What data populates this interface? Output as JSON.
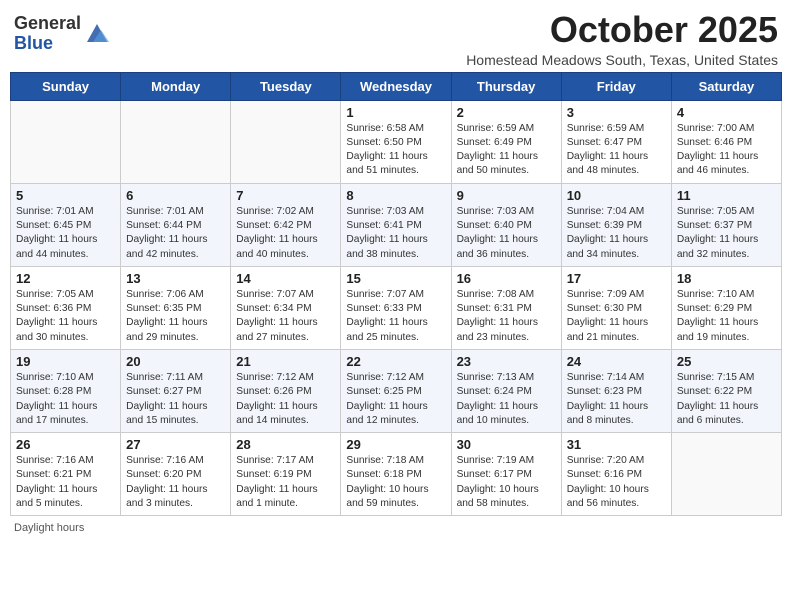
{
  "header": {
    "logo_general": "General",
    "logo_blue": "Blue",
    "month_title": "October 2025",
    "subtitle": "Homestead Meadows South, Texas, United States"
  },
  "weekdays": [
    "Sunday",
    "Monday",
    "Tuesday",
    "Wednesday",
    "Thursday",
    "Friday",
    "Saturday"
  ],
  "footer": "Daylight hours",
  "weeks": [
    [
      {
        "day": "",
        "info": ""
      },
      {
        "day": "",
        "info": ""
      },
      {
        "day": "",
        "info": ""
      },
      {
        "day": "1",
        "info": "Sunrise: 6:58 AM\nSunset: 6:50 PM\nDaylight: 11 hours and 51 minutes."
      },
      {
        "day": "2",
        "info": "Sunrise: 6:59 AM\nSunset: 6:49 PM\nDaylight: 11 hours and 50 minutes."
      },
      {
        "day": "3",
        "info": "Sunrise: 6:59 AM\nSunset: 6:47 PM\nDaylight: 11 hours and 48 minutes."
      },
      {
        "day": "4",
        "info": "Sunrise: 7:00 AM\nSunset: 6:46 PM\nDaylight: 11 hours and 46 minutes."
      }
    ],
    [
      {
        "day": "5",
        "info": "Sunrise: 7:01 AM\nSunset: 6:45 PM\nDaylight: 11 hours and 44 minutes."
      },
      {
        "day": "6",
        "info": "Sunrise: 7:01 AM\nSunset: 6:44 PM\nDaylight: 11 hours and 42 minutes."
      },
      {
        "day": "7",
        "info": "Sunrise: 7:02 AM\nSunset: 6:42 PM\nDaylight: 11 hours and 40 minutes."
      },
      {
        "day": "8",
        "info": "Sunrise: 7:03 AM\nSunset: 6:41 PM\nDaylight: 11 hours and 38 minutes."
      },
      {
        "day": "9",
        "info": "Sunrise: 7:03 AM\nSunset: 6:40 PM\nDaylight: 11 hours and 36 minutes."
      },
      {
        "day": "10",
        "info": "Sunrise: 7:04 AM\nSunset: 6:39 PM\nDaylight: 11 hours and 34 minutes."
      },
      {
        "day": "11",
        "info": "Sunrise: 7:05 AM\nSunset: 6:37 PM\nDaylight: 11 hours and 32 minutes."
      }
    ],
    [
      {
        "day": "12",
        "info": "Sunrise: 7:05 AM\nSunset: 6:36 PM\nDaylight: 11 hours and 30 minutes."
      },
      {
        "day": "13",
        "info": "Sunrise: 7:06 AM\nSunset: 6:35 PM\nDaylight: 11 hours and 29 minutes."
      },
      {
        "day": "14",
        "info": "Sunrise: 7:07 AM\nSunset: 6:34 PM\nDaylight: 11 hours and 27 minutes."
      },
      {
        "day": "15",
        "info": "Sunrise: 7:07 AM\nSunset: 6:33 PM\nDaylight: 11 hours and 25 minutes."
      },
      {
        "day": "16",
        "info": "Sunrise: 7:08 AM\nSunset: 6:31 PM\nDaylight: 11 hours and 23 minutes."
      },
      {
        "day": "17",
        "info": "Sunrise: 7:09 AM\nSunset: 6:30 PM\nDaylight: 11 hours and 21 minutes."
      },
      {
        "day": "18",
        "info": "Sunrise: 7:10 AM\nSunset: 6:29 PM\nDaylight: 11 hours and 19 minutes."
      }
    ],
    [
      {
        "day": "19",
        "info": "Sunrise: 7:10 AM\nSunset: 6:28 PM\nDaylight: 11 hours and 17 minutes."
      },
      {
        "day": "20",
        "info": "Sunrise: 7:11 AM\nSunset: 6:27 PM\nDaylight: 11 hours and 15 minutes."
      },
      {
        "day": "21",
        "info": "Sunrise: 7:12 AM\nSunset: 6:26 PM\nDaylight: 11 hours and 14 minutes."
      },
      {
        "day": "22",
        "info": "Sunrise: 7:12 AM\nSunset: 6:25 PM\nDaylight: 11 hours and 12 minutes."
      },
      {
        "day": "23",
        "info": "Sunrise: 7:13 AM\nSunset: 6:24 PM\nDaylight: 11 hours and 10 minutes."
      },
      {
        "day": "24",
        "info": "Sunrise: 7:14 AM\nSunset: 6:23 PM\nDaylight: 11 hours and 8 minutes."
      },
      {
        "day": "25",
        "info": "Sunrise: 7:15 AM\nSunset: 6:22 PM\nDaylight: 11 hours and 6 minutes."
      }
    ],
    [
      {
        "day": "26",
        "info": "Sunrise: 7:16 AM\nSunset: 6:21 PM\nDaylight: 11 hours and 5 minutes."
      },
      {
        "day": "27",
        "info": "Sunrise: 7:16 AM\nSunset: 6:20 PM\nDaylight: 11 hours and 3 minutes."
      },
      {
        "day": "28",
        "info": "Sunrise: 7:17 AM\nSunset: 6:19 PM\nDaylight: 11 hours and 1 minute."
      },
      {
        "day": "29",
        "info": "Sunrise: 7:18 AM\nSunset: 6:18 PM\nDaylight: 10 hours and 59 minutes."
      },
      {
        "day": "30",
        "info": "Sunrise: 7:19 AM\nSunset: 6:17 PM\nDaylight: 10 hours and 58 minutes."
      },
      {
        "day": "31",
        "info": "Sunrise: 7:20 AM\nSunset: 6:16 PM\nDaylight: 10 hours and 56 minutes."
      },
      {
        "day": "",
        "info": ""
      }
    ]
  ]
}
